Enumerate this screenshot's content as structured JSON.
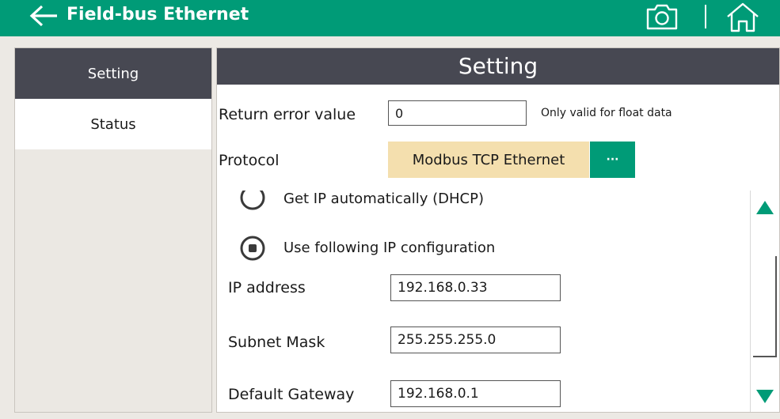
{
  "header": {
    "title": "Field-bus Ethernet",
    "back_icon": "arrow-left-icon",
    "camera_icon": "camera-icon",
    "home_icon": "home-icon",
    "bg_color": "#009b77"
  },
  "sidebar": {
    "items": [
      {
        "label": "Setting",
        "active": true
      },
      {
        "label": "Status",
        "active": false
      }
    ]
  },
  "panel": {
    "title": "Setting",
    "return_error": {
      "label": "Return error value",
      "value": "0",
      "hint": "Only valid for float data"
    },
    "protocol": {
      "label": "Protocol",
      "value": "Modbus TCP Ethernet",
      "more_label": "···"
    },
    "ip_mode": {
      "options": [
        {
          "label": "Get IP automatically (DHCP)",
          "selected": false
        },
        {
          "label": "Use following IP configuration",
          "selected": true
        }
      ]
    },
    "ip_address": {
      "label": "IP address",
      "value": "192.168.0.33"
    },
    "subnet_mask": {
      "label": "Subnet Mask",
      "value": "255.255.255.0"
    },
    "default_gateway": {
      "label": "Default Gateway",
      "value": "192.168.0.1"
    }
  },
  "colors": {
    "accent": "#009b77",
    "header_dark": "#474852",
    "protocol_bg": "#f4dfae"
  }
}
